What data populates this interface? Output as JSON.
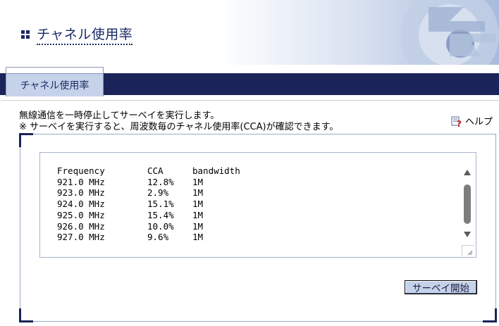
{
  "header": {
    "title": "チャネル使用率"
  },
  "tabs": [
    {
      "label": "チャネル使用率",
      "active": true
    }
  ],
  "description": {
    "line1": "無線通信を一時停止してサーベイを実行します。",
    "line2": "※ サーベイを実行すると、周波数毎のチャネル使用率(CCA)が確認できます。"
  },
  "help": {
    "label": "ヘルプ",
    "icon": "help-question-icon"
  },
  "results": {
    "columns": [
      "Frequency",
      "CCA",
      "bandwidth"
    ],
    "rows": [
      [
        "921.0 MHz",
        "12.8%",
        "1M"
      ],
      [
        "923.0 MHz",
        "2.9%",
        "1M"
      ],
      [
        "924.0 MHz",
        "15.1%",
        "1M"
      ],
      [
        "925.0 MHz",
        "15.4%",
        "1M"
      ],
      [
        "926.0 MHz",
        "10.0%",
        "1M"
      ],
      [
        "927.0 MHz",
        "9.6%",
        "1M"
      ]
    ]
  },
  "actions": {
    "survey_start_label": "サーベイ開始"
  },
  "colors": {
    "navy": "#1b2459",
    "tab_bg": "#c5d2ea",
    "title_text": "#1a2a66"
  }
}
